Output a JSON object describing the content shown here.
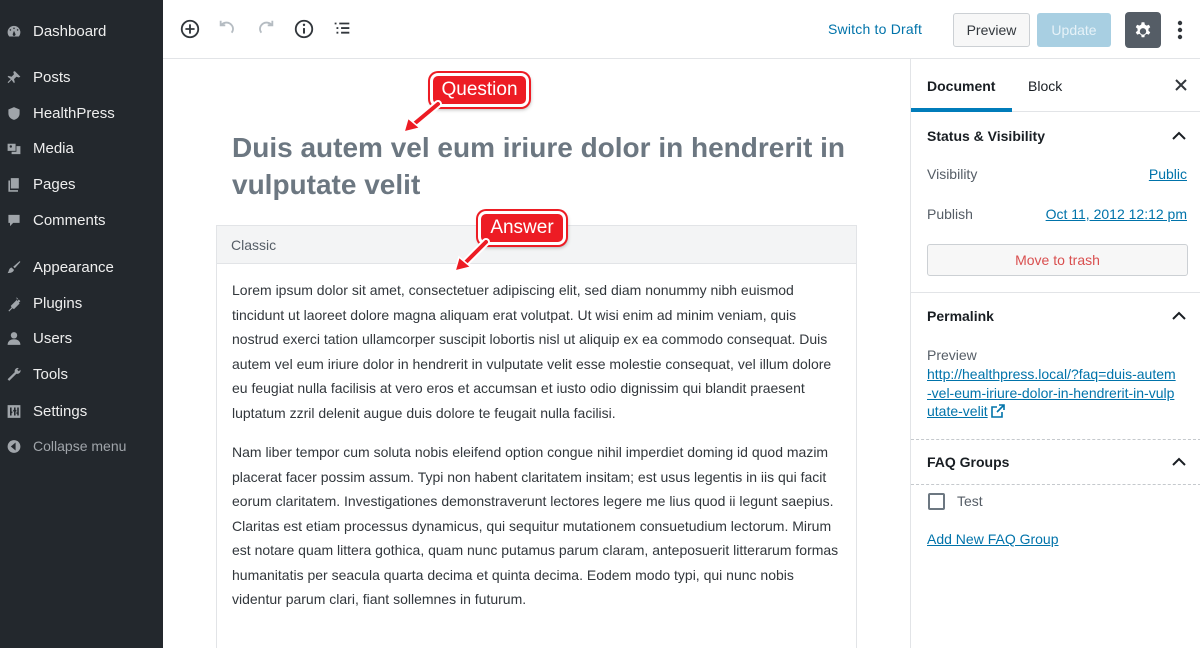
{
  "sidebar": {
    "items": [
      {
        "label": "Dashboard",
        "icon": "dashboard-icon"
      },
      {
        "label": "Posts",
        "icon": "pin-icon"
      },
      {
        "label": "HealthPress",
        "icon": "shield-icon"
      },
      {
        "label": "Media",
        "icon": "media-icon"
      },
      {
        "label": "Pages",
        "icon": "pages-icon"
      },
      {
        "label": "Comments",
        "icon": "comment-icon"
      },
      {
        "label": "Appearance",
        "icon": "brush-icon"
      },
      {
        "label": "Plugins",
        "icon": "plugin-icon"
      },
      {
        "label": "Users",
        "icon": "user-icon"
      },
      {
        "label": "Tools",
        "icon": "wrench-icon"
      },
      {
        "label": "Settings",
        "icon": "settings-icon"
      }
    ],
    "collapse_label": "Collapse menu"
  },
  "toolbar": {
    "switch_draft": "Switch to Draft",
    "preview": "Preview",
    "update": "Update"
  },
  "editor": {
    "title": "Duis autem vel eum iriure dolor in hendrerit in vulputate velit",
    "classic_label": "Classic",
    "paragraphs": [
      "Lorem ipsum dolor sit amet, consectetuer adipiscing elit, sed diam nonummy nibh euismod tincidunt ut laoreet dolore magna aliquam erat volutpat. Ut wisi enim ad minim veniam, quis nostrud exerci tation ullamcorper suscipit lobortis nisl ut aliquip ex ea commodo consequat. Duis autem vel eum iriure dolor in hendrerit in vulputate velit esse molestie consequat, vel illum dolore eu feugiat nulla facilisis at vero eros et accumsan et iusto odio dignissim qui blandit praesent luptatum zzril delenit augue duis dolore te feugait nulla facilisi.",
      "Nam liber tempor cum soluta nobis eleifend option congue nihil imperdiet doming id quod mazim placerat facer possim assum. Typi non habent claritatem insitam; est usus legentis in iis qui facit eorum claritatem. Investigationes demonstraverunt lectores legere me lius quod ii legunt saepius. Claritas est etiam processus dynamicus, qui sequitur mutationem consuetudium lectorum. Mirum est notare quam littera gothica, quam nunc putamus parum claram, anteposuerit litterarum formas humanitatis per seacula quarta decima et quinta decima. Eodem modo typi, qui nunc nobis videntur parum clari, fiant sollemnes in futurum."
    ]
  },
  "annotations": {
    "question": "Question",
    "answer": "Answer",
    "color": "#ed1c24"
  },
  "panel": {
    "tab_document": "Document",
    "tab_block": "Block",
    "status_title": "Status & Visibility",
    "visibility_label": "Visibility",
    "visibility_value": "Public",
    "publish_label": "Publish",
    "publish_value": "Oct 11, 2012 12:12 pm",
    "trash_button": "Move to trash",
    "permalink_title": "Permalink",
    "preview_label": "Preview",
    "permalink_url": "http://healthpress.local/?faq=duis-autem-vel-eum-iriure-dolor-in-hendrerit-in-vulputate-velit",
    "faq_title": "FAQ Groups",
    "faq_option": "Test",
    "add_faq": "Add New FAQ Group"
  },
  "colors": {
    "sidebar_bg": "#23282d",
    "link": "#0073aa",
    "accent": "#007cba"
  }
}
